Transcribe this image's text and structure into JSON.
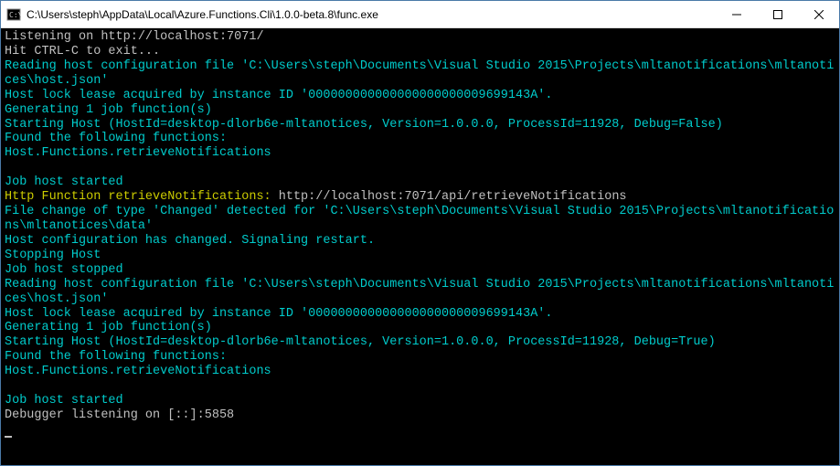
{
  "window": {
    "title": "C:\\Users\\steph\\AppData\\Local\\Azure.Functions.Cli\\1.0.0-beta.8\\func.exe"
  },
  "lines": [
    {
      "cls": "c-white",
      "text": "Listening on http://localhost:7071/"
    },
    {
      "cls": "c-white",
      "text": "Hit CTRL-C to exit..."
    },
    {
      "cls": "c-cyan",
      "text": "Reading host configuration file 'C:\\Users\\steph\\Documents\\Visual Studio 2015\\Projects\\mltanotifications\\mltanotices\\host.json'"
    },
    {
      "cls": "c-cyan",
      "text": "Host lock lease acquired by instance ID '000000000000000000000009699143A'."
    },
    {
      "cls": "c-cyan",
      "text": "Generating 1 job function(s)"
    },
    {
      "cls": "c-cyan",
      "text": "Starting Host (HostId=desktop-dlorb6e-mltanotices, Version=1.0.0.0, ProcessId=11928, Debug=False)"
    },
    {
      "cls": "c-cyan",
      "text": "Found the following functions:"
    },
    {
      "cls": "c-cyan",
      "text": "Host.Functions.retrieveNotifications"
    },
    {
      "cls": "c-cyan",
      "text": ""
    },
    {
      "cls": "c-cyan",
      "text": "Job host started"
    },
    {
      "cls": "mixed",
      "label": "Http Function retrieveNotifications:",
      "url": " http://localhost:7071/api/retrieveNotifications"
    },
    {
      "cls": "c-cyan",
      "text": "File change of type 'Changed' detected for 'C:\\Users\\steph\\Documents\\Visual Studio 2015\\Projects\\mltanotifications\\mltanotices\\data'"
    },
    {
      "cls": "c-cyan",
      "text": "Host configuration has changed. Signaling restart."
    },
    {
      "cls": "c-cyan",
      "text": "Stopping Host"
    },
    {
      "cls": "c-cyan",
      "text": "Job host stopped"
    },
    {
      "cls": "c-cyan",
      "text": "Reading host configuration file 'C:\\Users\\steph\\Documents\\Visual Studio 2015\\Projects\\mltanotifications\\mltanotices\\host.json'"
    },
    {
      "cls": "c-cyan",
      "text": "Host lock lease acquired by instance ID '000000000000000000000009699143A'."
    },
    {
      "cls": "c-cyan",
      "text": "Generating 1 job function(s)"
    },
    {
      "cls": "c-cyan",
      "text": "Starting Host (HostId=desktop-dlorb6e-mltanotices, Version=1.0.0.0, ProcessId=11928, Debug=True)"
    },
    {
      "cls": "c-cyan",
      "text": "Found the following functions:"
    },
    {
      "cls": "c-cyan",
      "text": "Host.Functions.retrieveNotifications"
    },
    {
      "cls": "c-cyan",
      "text": ""
    },
    {
      "cls": "c-cyan",
      "text": "Job host started"
    },
    {
      "cls": "c-white",
      "text": "Debugger listening on [::]:5858"
    }
  ]
}
